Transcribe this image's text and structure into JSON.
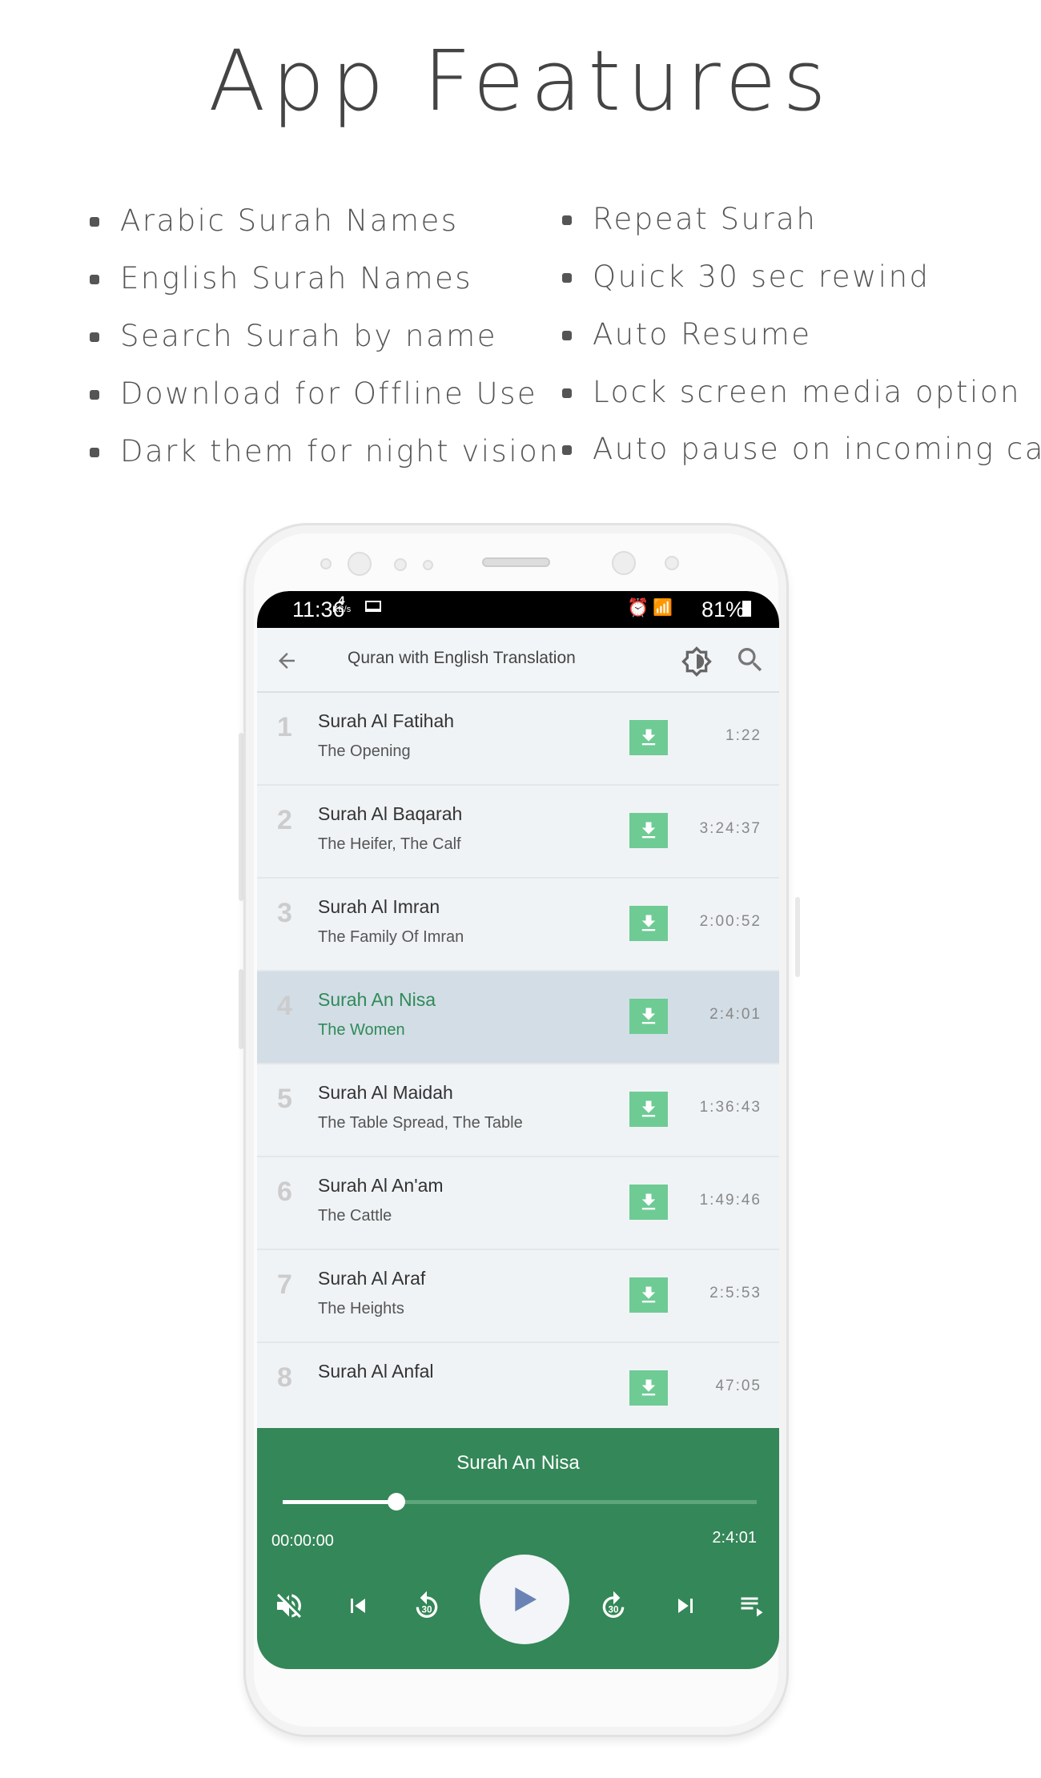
{
  "heading": "App Features",
  "features_left": [
    "Arabic Surah Names",
    "English Surah Names",
    "Search Surah by name",
    "Download for Offline Use",
    "Dark them for night vision"
  ],
  "features_right": [
    "Repeat Surah",
    "Quick 30 sec rewind",
    "Auto Resume",
    "Lock screen media option",
    "Auto pause on incoming call"
  ],
  "status": {
    "time": "11:36",
    "speed_value": "4",
    "speed_unit": "KB/s",
    "battery": "81%"
  },
  "toolbar": {
    "title": "Quran with English Translation",
    "icons": [
      "arrow-back-icon",
      "brightness-icon",
      "search-icon"
    ]
  },
  "surahs": [
    {
      "num": "1",
      "title": "Surah Al Fatihah",
      "subtitle": "The Opening",
      "duration": "1:22"
    },
    {
      "num": "2",
      "title": "Surah Al Baqarah",
      "subtitle": "The Heifer, The Calf",
      "duration": "3:24:37"
    },
    {
      "num": "3",
      "title": "Surah Al Imran",
      "subtitle": "The Family Of Imran",
      "duration": "2:00:52"
    },
    {
      "num": "4",
      "title": "Surah An Nisa",
      "subtitle": "The Women",
      "duration": "2:4:01",
      "selected": true
    },
    {
      "num": "5",
      "title": "Surah Al Maidah",
      "subtitle": "The Table Spread, The Table",
      "duration": "1:36:43"
    },
    {
      "num": "6",
      "title": "Surah Al An'am",
      "subtitle": "The Cattle",
      "duration": "1:49:46"
    },
    {
      "num": "7",
      "title": "Surah Al Araf",
      "subtitle": "The Heights",
      "duration": "2:5:53"
    },
    {
      "num": "8",
      "title": "Surah Al Anfal",
      "subtitle": "",
      "duration": "47:05"
    }
  ],
  "player": {
    "title": "Surah An Nisa",
    "elapsed": "00:00:00",
    "total": "2:4:01",
    "progress": 0.24
  },
  "colors": {
    "accent": "#348758",
    "download": "#6ecb94",
    "selected_row": "#d3dde6",
    "selected_text": "#2e8b57"
  }
}
